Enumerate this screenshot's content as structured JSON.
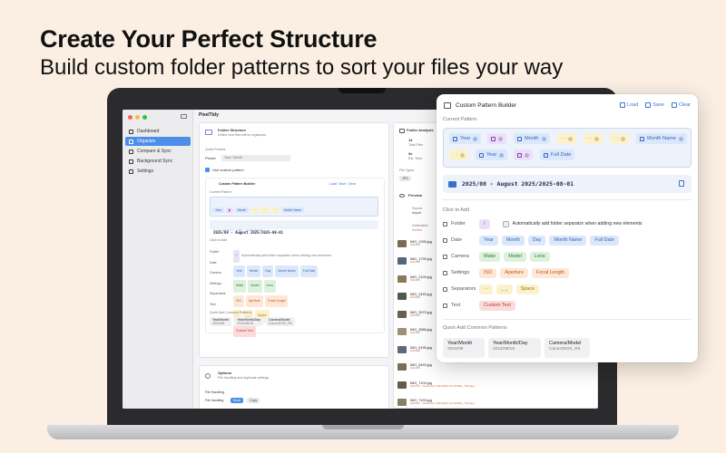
{
  "hero": {
    "headline": "Create Your Perfect Structure",
    "subline": "Build custom folder patterns to sort your files your way"
  },
  "app": {
    "name": "PixelTidy",
    "nav": [
      "Dashboard",
      "Organize",
      "Compare & Sync",
      "Background Sync",
      "Settings"
    ],
    "active_nav": "Organize",
    "folder_structure": {
      "title": "Folder Structure",
      "subtitle": "Define how files will be organized",
      "quick_presets": "Quick Presets",
      "preset_label": "Preset",
      "preset_value": "Year / Month",
      "use_custom": "Use custom pattern",
      "builder_title": "Custom Pattern Builder",
      "current_pattern": "Current Pattern",
      "path": "2025/08 - August 2025/2025-08-01",
      "click_to_add": "Click to Add",
      "rows": [
        "Folder",
        "Date",
        "Camera",
        "Settings",
        "Separators",
        "Text"
      ],
      "quick_add": "Quick Add Common Patterns"
    },
    "options": {
      "title": "Options",
      "subtitle": "File handling and duplicate settings",
      "file_handling": "File Handling",
      "file_handling_label": "File handling",
      "move": "Move",
      "copy": "Copy"
    },
    "analysis": {
      "title": "Folder Analysis",
      "total_files_value": "14",
      "total_files_label": "Total Files",
      "est_time_value": "3s",
      "est_time_label": "Est. Time",
      "file_types_label": "File Types",
      "file_type": "JPG"
    },
    "preview": {
      "title": "Preview",
      "source": "Source",
      "source_value": "Import",
      "destination": "Destination",
      "destination_value": "Sorted",
      "files": [
        {
          "name": "IMG_1295.jpg",
          "dest": "2024/08"
        },
        {
          "name": "IMG_1739.jpg",
          "dest": "2024/08"
        },
        {
          "name": "IMG_2109.jpg",
          "dest": "2024/08"
        },
        {
          "name": "IMG_2459.jpg",
          "dest": "2024/08"
        },
        {
          "name": "IMG_2675.jpg",
          "dest": "2024/08"
        },
        {
          "name": "IMG_3588.jpg",
          "dest": "2024/08"
        },
        {
          "name": "IMG_5195.jpg",
          "dest": "2024/08"
        },
        {
          "name": "IMG_6493.jpg",
          "dest": "2024/08"
        },
        {
          "name": "IMG_7104.jpg",
          "dest": "2024/12 · December 2024/2024-12-16/IMG_7104.jpg"
        },
        {
          "name": "IMG_7193.jpg",
          "dest": "2024/12 · December 2024/2024-12-16/IMG_7193.jpg"
        }
      ]
    }
  },
  "popup": {
    "title": "Custom Pattern Builder",
    "actions": {
      "load": "Load",
      "save": "Save",
      "clear": "Clear"
    },
    "current_pattern_label": "Current Pattern",
    "pattern_tokens": [
      {
        "label": "Year",
        "kind": "blue"
      },
      {
        "label": "",
        "kind": "purple"
      },
      {
        "label": "Month",
        "kind": "blue"
      },
      {
        "label": "",
        "kind": "yellow"
      },
      {
        "label": "",
        "kind": "yellow"
      },
      {
        "label": "",
        "kind": "yellow"
      },
      {
        "label": "Month Name",
        "kind": "blue"
      },
      {
        "label": "",
        "kind": "yellow"
      },
      {
        "label": "Year",
        "kind": "blue"
      },
      {
        "label": "",
        "kind": "purple"
      },
      {
        "label": "Full Date",
        "kind": "blue"
      }
    ],
    "path": "2025/08 - August 2025/2025-08-01",
    "click_to_add": "Click to Add",
    "folder_label": "Folder",
    "folder_chip": "/",
    "auto_separator": "Automatically add folder separator when adding new elements",
    "date_label": "Date",
    "date_chips": [
      "Year",
      "Month",
      "Day",
      "Month Name",
      "Full Date"
    ],
    "camera_label": "Camera",
    "camera_chips": [
      "Make",
      "Model",
      "Lens"
    ],
    "settings_label": "Settings",
    "settings_chips": [
      "ISO",
      "Aperture",
      "Focal Length"
    ],
    "separators_label": "Separators",
    "separator_chips": [
      "- -",
      "_ _",
      "Space"
    ],
    "text_label": "Text",
    "text_chip": "Custom Text",
    "quick_add_label": "Quick Add Common Patterns",
    "quick_add": [
      {
        "title": "Year/Month",
        "example": "2024/08"
      },
      {
        "title": "Year/Month/Day",
        "example": "2024/08/15"
      },
      {
        "title": "Camera/Model",
        "example": "Canon/EOS_R5"
      }
    ]
  },
  "colors": {
    "background": "#fbefe4",
    "accent": "#3b73d1",
    "active_nav": "#4c8ee8"
  }
}
